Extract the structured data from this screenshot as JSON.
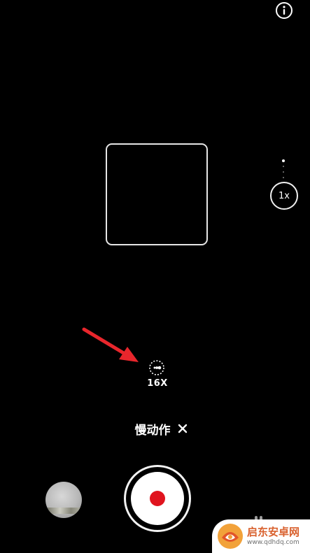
{
  "zoom": {
    "label": "1x"
  },
  "speed": {
    "label": "16X"
  },
  "mode": {
    "label": "慢动作"
  },
  "watermark": {
    "title": "启东安卓网",
    "url": "www.qdhdq.com"
  },
  "icons": {
    "info": "info-icon",
    "close": "close-icon",
    "speed": "slow-motion-icon",
    "arrow": "annotation-arrow",
    "logo": "logo-icon"
  },
  "colors": {
    "background": "#000000",
    "record": "#e0141e",
    "arrow": "#e8262c",
    "watermark": "#d9612e"
  }
}
